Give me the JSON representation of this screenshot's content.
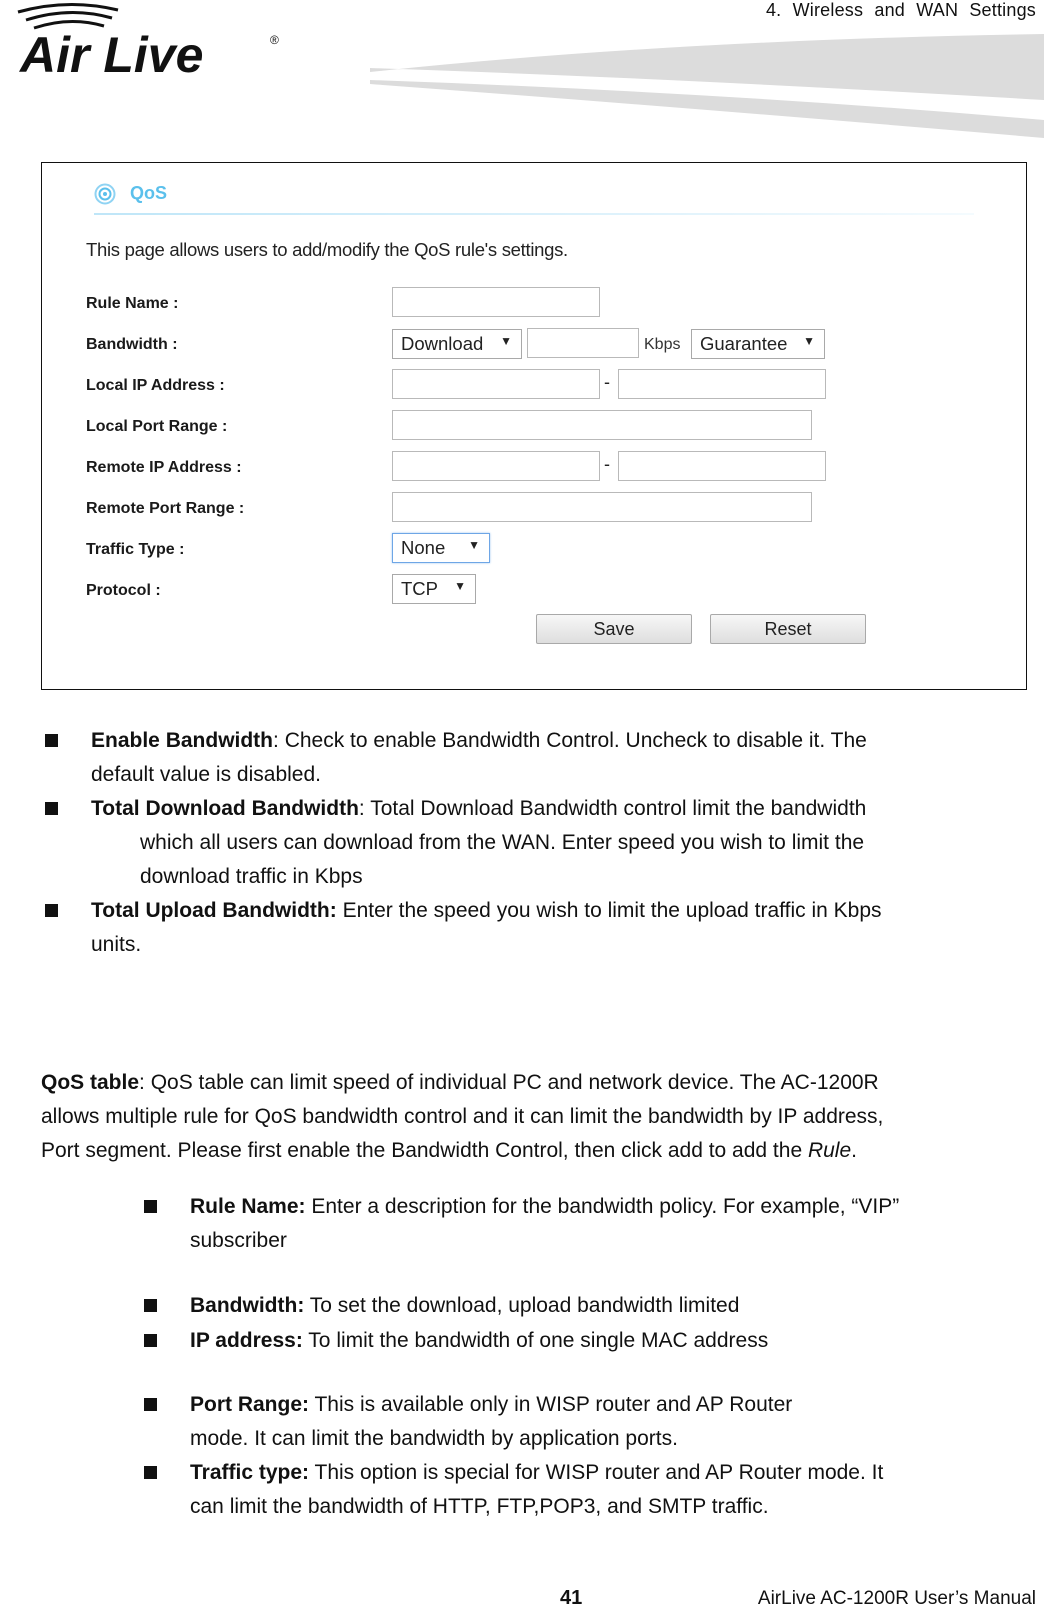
{
  "header": {
    "brand": "Air Live",
    "chapter_title": "4.  Wireless  and  WAN  Settings"
  },
  "screenshot": {
    "section_title": "QoS",
    "description": "This page allows users to add/modify the QoS rule's settings.",
    "form": {
      "rule_name_label": "Rule Name :",
      "rule_name_value": "",
      "bandwidth_label": "Bandwidth :",
      "bandwidth_direction": "Download",
      "bandwidth_value": "",
      "bandwidth_unit": "Kbps",
      "bandwidth_mode": "Guarantee",
      "local_ip_label": "Local IP Address :",
      "local_ip_start": "",
      "local_ip_end": "",
      "range_separator": "-",
      "local_port_label": "Local Port Range :",
      "local_port_value": "",
      "remote_ip_label": "Remote IP Address :",
      "remote_ip_start": "",
      "remote_ip_end": "",
      "remote_port_label": "Remote Port Range :",
      "remote_port_value": "",
      "traffic_type_label": "Traffic Type :",
      "traffic_type_value": "None",
      "protocol_label": "Protocol :",
      "protocol_value": "TCP",
      "dropdown_arrow": "▼",
      "save_label": "Save",
      "reset_label": "Reset"
    },
    "colors": {
      "accent": "#5bc0ec",
      "focus_border": "#6ea6e6"
    }
  },
  "top_bullets": [
    {
      "term": "Enable Bandwidth",
      "sep": ": ",
      "line1": "Check to enable Bandwidth Control. Uncheck to disable it. The",
      "line2": "default value is disabled."
    },
    {
      "term": "Total Download Bandwidth",
      "sep": ": ",
      "line1": "Total Download Bandwidth control limit the bandwidth",
      "line2": "which all users can download from the WAN. Enter speed you wish to limit the",
      "line3": "download traffic in Kbps"
    },
    {
      "term": "Total Upload Bandwidth:",
      "sep": " ",
      "line1": "Enter the speed you wish to limit the upload traffic in Kbps",
      "line2": "units."
    }
  ],
  "qos_table": {
    "term": "QoS table",
    "line1": ": QoS table can limit speed of individual PC and network device. The AC-1200R",
    "line2": "allows multiple rule for QoS bandwidth control and it can limit the bandwidth by IP address,",
    "line3_prefix": "Port segment. Please first enable the Bandwidth Control, then click add to add the ",
    "line3_italic": "Rule",
    "line3_suffix": "."
  },
  "rule_bullets": [
    {
      "term": "Rule Name:",
      "line1": " Enter a description for the bandwidth policy. For example, “VIP”",
      "line2": "subscriber"
    },
    {
      "term": "Bandwidth:",
      "line1": " To set the download, upload bandwidth limited"
    },
    {
      "term": "IP address:",
      "line1": " To limit the bandwidth of one single MAC address"
    },
    {
      "term": "Port Range:",
      "line1": " This is available only in WISP router and AP Router",
      "line2": "mode. It can limit the bandwidth by application ports."
    },
    {
      "term": "Traffic type:",
      "line1": " This option is special for WISP router and AP Router mode. It",
      "line2": "can limit the bandwidth of HTTP, FTP,POP3, and SMTP traffic."
    }
  ],
  "footer": {
    "page_number": "41",
    "manual_title": "AirLive AC-1200R User’s Manual"
  }
}
